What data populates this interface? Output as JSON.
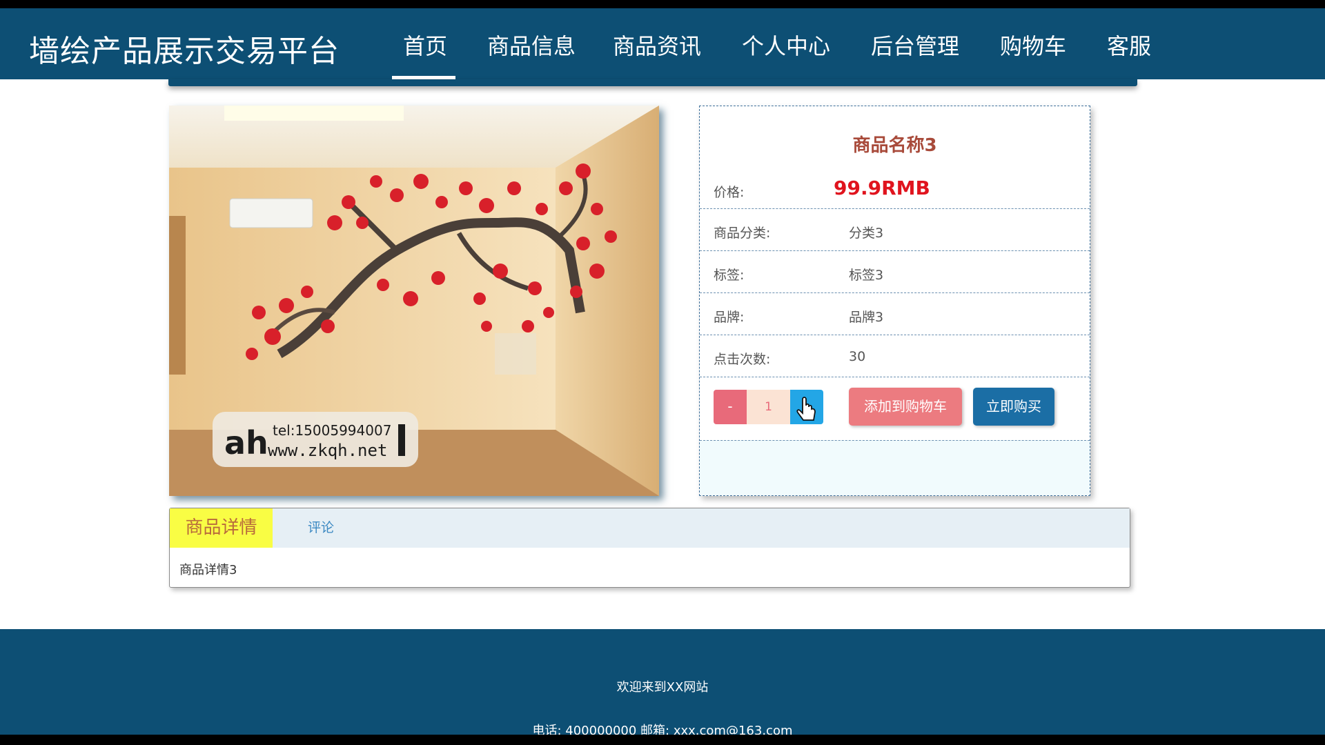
{
  "header": {
    "title": "墙绘产品展示交易平台",
    "nav": [
      "首页",
      "商品信息",
      "商品资讯",
      "个人中心",
      "后台管理",
      "购物车",
      "客服"
    ]
  },
  "product": {
    "name": "商品名称3",
    "price_label": "价格:",
    "price": "99.9RMB",
    "rows": [
      {
        "label": "商品分类:",
        "value": "分类3"
      },
      {
        "label": "标签:",
        "value": "标签3"
      },
      {
        "label": "品牌:",
        "value": "品牌3"
      },
      {
        "label": "点击次数:",
        "value": "30"
      }
    ],
    "qty_minus": "-",
    "qty_value": "1",
    "add_to_cart": "添加到购物车",
    "buy_now": "立即购买",
    "image_watermark": {
      "tel": "tel:15005994007",
      "url": "www.zkqh.net"
    }
  },
  "tabs": {
    "details_label": "商品详情",
    "comments_label": "评论",
    "details_text": "商品详情3"
  },
  "footer": {
    "welcome": "欢迎来到XX网站",
    "contact": "电话: 400000000  邮箱: xxx.com@163.com"
  },
  "colors": {
    "header_bg": "#0d4f74",
    "price": "#e0141e",
    "add_to_cart": "#ec7b80",
    "buy_now": "#1b6ea5",
    "tab_active": "#f9fd44"
  }
}
